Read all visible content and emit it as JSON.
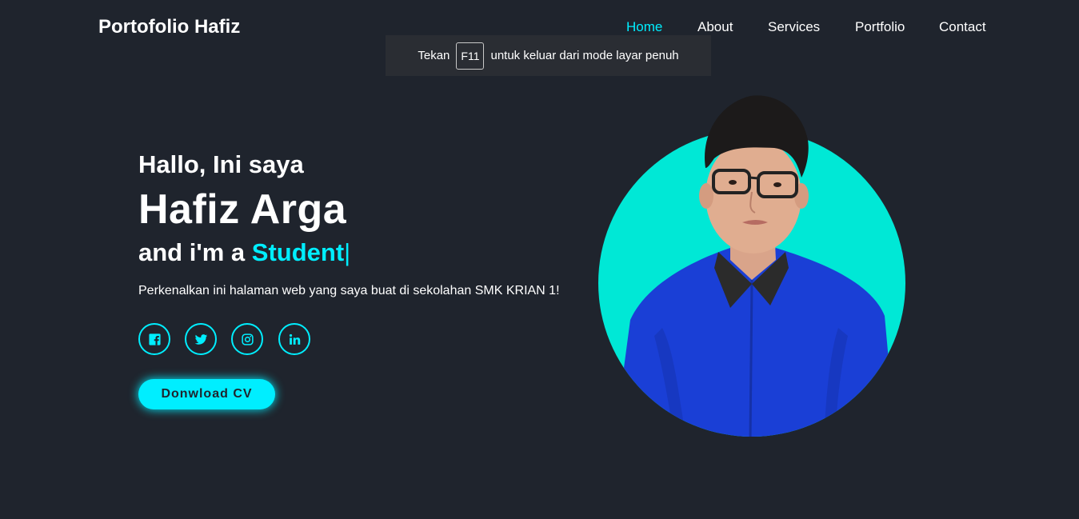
{
  "header": {
    "logo": "Portofolio Hafiz",
    "nav": [
      "Home",
      "About",
      "Services",
      "Portfolio",
      "Contact"
    ],
    "active": "Home"
  },
  "fullscreen_notice": {
    "before": "Tekan",
    "key": "F11",
    "after": "untuk keluar dari mode layar penuh"
  },
  "home": {
    "greeting": "Hallo, Ini saya",
    "name": "Hafiz Arga",
    "role_prefix": "and i'm a",
    "role": "Student",
    "cursor": "|",
    "intro": "Perkenalkan ini halaman web yang saya buat di sekolahan SMK KRIAN 1!",
    "socials": [
      "facebook-icon",
      "twitter-icon",
      "instagram-icon",
      "linkedin-icon"
    ],
    "cv_button": "Donwload CV"
  },
  "colors": {
    "background": "#1f242d",
    "accent": "#00eeff",
    "photo_circle": "#00e8d6",
    "text": "#ffffff"
  }
}
